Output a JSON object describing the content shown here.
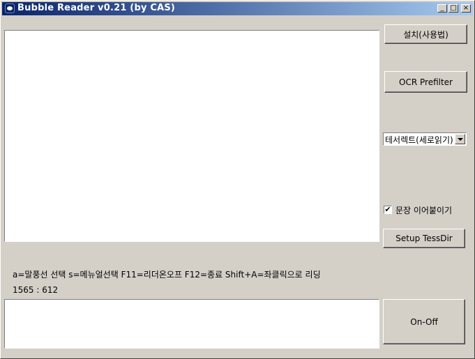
{
  "window": {
    "title": "Bubble Reader v0.21 (by CAS)"
  },
  "titlebar_buttons": {
    "minimize": "_",
    "maximize": "□",
    "close": "×"
  },
  "buttons": {
    "install": "설치(사용법)",
    "ocr_prefilter": "OCR Prefilter",
    "setup_tessdir": "Setup TessDir",
    "on_off": "On-Off"
  },
  "language_select": {
    "value": "테서렉트(세로읽기)"
  },
  "checkbox": {
    "label": "문장 이어붙이기",
    "checked": true,
    "mark": "✔"
  },
  "hint_text": "a=말풍선 선택 s=메뉴얼선택 F11=리더온오프 F12=종료 Shift+A=좌클릭으로 리딩",
  "coords": "1565 : 612",
  "output_text": ""
}
